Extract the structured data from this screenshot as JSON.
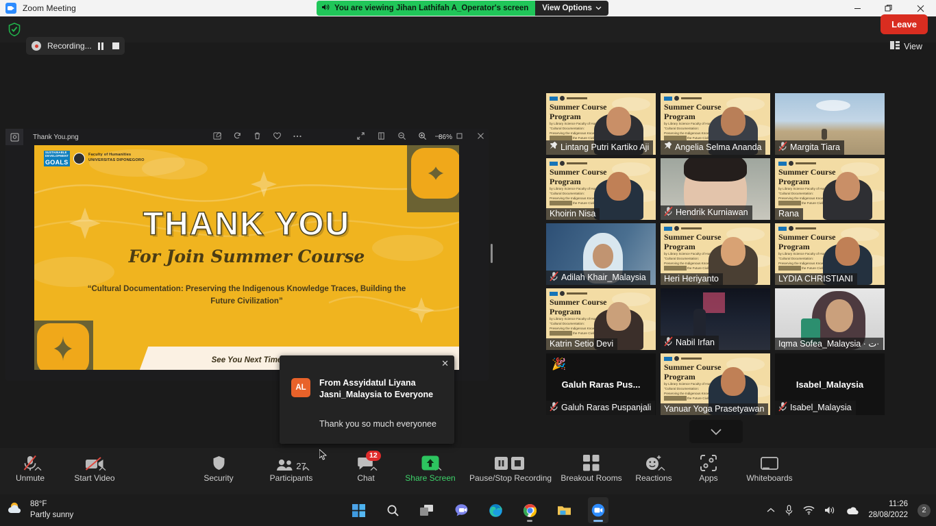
{
  "window": {
    "title": "Zoom Meeting",
    "minimize_label": "Minimize",
    "restore_label": "Restore",
    "close_label": "Close"
  },
  "share_banner": {
    "text": "You are viewing Jihan Lathifah A_Operator's screen",
    "view_options_label": "View Options",
    "speaker_icon": "speaker-icon",
    "chevron": "chevron-down-icon",
    "green": "#20c659"
  },
  "top_strip": {
    "shield_icon": "security-shield-icon",
    "recording_label": "Recording...",
    "pause_icon": "pause-icon",
    "stop_icon": "stop-icon",
    "view_label": "View",
    "view_icon": "layout-view-icon"
  },
  "viewer": {
    "file_name": "Thank You.png",
    "zoom_level": "86%",
    "thumbnail_icon": "image-thumbnail-icon",
    "toolbar_icons": [
      "markup-icon",
      "rotate-icon",
      "delete-icon",
      "favorite-heart-icon",
      "more-ellipsis-icon"
    ],
    "right_icons": [
      "fullscreen-icon",
      "fit-page-icon",
      "zoom-out-icon",
      "zoom-in-icon"
    ],
    "window_icons": [
      "minimize-icon",
      "restore-icon",
      "close-icon"
    ]
  },
  "slide": {
    "sdg_line1": "SUSTAINABLE",
    "sdg_line2": "DEVELOPMENT",
    "sdg_line3": "GOALS",
    "faculty_line1": "Faculty of Humanities",
    "faculty_line2": "UNIVERSITAS DIPONEGORO",
    "title": "THANK YOU",
    "subtitle": "For Join Summer Course",
    "quote": "“Cultural Documentation: Preserving the Indigenous Knowledge Traces, Building the Future Civilization”",
    "footer": "See You Next Time",
    "bg_color": "#f0b41f"
  },
  "chat_toast": {
    "avatar_initials": "AL",
    "avatar_color": "#e8622a",
    "from": "From Assyidatul Liyana Jasni_Malaysia to Everyone",
    "message": "Thank you so much everyonee",
    "close_icon": "close-icon"
  },
  "gallery": {
    "active_border_color": "#d9e021",
    "scroll_down_icon": "chevron-down-icon",
    "tiles": [
      {
        "name": "Lintang Putri Kartiko Aji",
        "muted": false,
        "pinned": true,
        "video": true,
        "type": "poster-person",
        "active": false
      },
      {
        "name": "Angelia Selma Ananda",
        "muted": false,
        "pinned": true,
        "video": true,
        "type": "poster-person",
        "active": false
      },
      {
        "name": "Margita Tiara",
        "muted": true,
        "pinned": false,
        "video": true,
        "type": "outdoor",
        "active": false
      },
      {
        "name": "Khoirin Nisa",
        "muted": false,
        "pinned": false,
        "video": true,
        "type": "poster-person",
        "active": false
      },
      {
        "name": "Hendrik Kurniawan",
        "muted": true,
        "pinned": false,
        "video": true,
        "type": "face-closeup",
        "active": false
      },
      {
        "name": "Rana",
        "muted": false,
        "pinned": false,
        "video": true,
        "type": "poster-person",
        "active": false
      },
      {
        "name": "Adilah Khair_Malaysia",
        "muted": true,
        "pinned": false,
        "video": true,
        "type": "indoor-blue",
        "active": false
      },
      {
        "name": "Heri Heriyanto",
        "muted": false,
        "pinned": false,
        "video": true,
        "type": "poster-person",
        "active": false
      },
      {
        "name": "LYDIA CHRISTIANI",
        "muted": false,
        "pinned": false,
        "video": true,
        "type": "poster-person",
        "active": true
      },
      {
        "name": "Katrin Setio Devi",
        "muted": false,
        "pinned": false,
        "video": true,
        "type": "poster-person",
        "active": false
      },
      {
        "name": "Nabil Irfan",
        "muted": true,
        "pinned": false,
        "video": true,
        "type": "night-street",
        "active": false
      },
      {
        "name": "Iqma Sofea_Malaysia · ت·",
        "muted": false,
        "pinned": false,
        "video": true,
        "type": "selfie-indoor",
        "active": false
      },
      {
        "name": "Galuh Raras Puspanjali",
        "display_name": "Galuh Raras Pus...",
        "muted": true,
        "pinned": false,
        "video": false,
        "type": "no-video",
        "reaction": "🎉",
        "active": false
      },
      {
        "name": "Yanuar Yoga Prasetyawan",
        "muted": false,
        "pinned": false,
        "video": true,
        "type": "poster-person",
        "active": false
      },
      {
        "name": "Isabel_Malaysia",
        "display_name": "Isabel_Malaysia",
        "muted": true,
        "pinned": false,
        "video": false,
        "type": "no-video",
        "active": true
      }
    ]
  },
  "controls": [
    {
      "id": "unmute",
      "label": "Unmute",
      "icon": "mic-muted-icon",
      "caret": true,
      "badge": null,
      "count": null,
      "highlight": null
    },
    {
      "id": "start-video",
      "label": "Start Video",
      "icon": "camera-off-icon",
      "caret": true,
      "badge": null,
      "count": null,
      "highlight": null
    },
    {
      "id": "security",
      "label": "Security",
      "icon": "shield-icon",
      "caret": false,
      "badge": null,
      "count": null,
      "highlight": null
    },
    {
      "id": "participants",
      "label": "Participants",
      "icon": "people-icon",
      "caret": true,
      "badge": null,
      "count": "27",
      "highlight": null
    },
    {
      "id": "chat",
      "label": "Chat",
      "icon": "chat-bubble-icon",
      "caret": true,
      "badge": "12",
      "count": null,
      "highlight": null
    },
    {
      "id": "share-screen",
      "label": "Share Screen",
      "icon": "share-screen-icon",
      "caret": true,
      "badge": null,
      "count": null,
      "highlight": "#3ed46b"
    },
    {
      "id": "recording",
      "label": "Pause/Stop Recording",
      "icon": "pause-stop-icon",
      "caret": false,
      "badge": null,
      "count": null,
      "highlight": null
    },
    {
      "id": "breakout",
      "label": "Breakout Rooms",
      "icon": "grid-rooms-icon",
      "caret": false,
      "badge": null,
      "count": null,
      "highlight": null
    },
    {
      "id": "reactions",
      "label": "Reactions",
      "icon": "smiley-plus-icon",
      "caret": true,
      "badge": null,
      "count": null,
      "highlight": null
    },
    {
      "id": "apps",
      "label": "Apps",
      "icon": "apps-icon",
      "caret": false,
      "badge": null,
      "count": null,
      "highlight": null
    },
    {
      "id": "whiteboards",
      "label": "Whiteboards",
      "icon": "whiteboard-icon",
      "caret": false,
      "badge": null,
      "count": null,
      "highlight": null
    }
  ],
  "leave_button": {
    "label": "Leave",
    "color": "#d92d20"
  },
  "taskbar": {
    "weather_temp": "88°F",
    "weather_desc": "Partly sunny",
    "weather_icon": "partly-sunny-icon",
    "apps": [
      {
        "id": "start",
        "icon": "windows-start-icon",
        "state": "idle"
      },
      {
        "id": "search",
        "icon": "search-icon",
        "state": "idle"
      },
      {
        "id": "task-view",
        "icon": "task-view-icon",
        "state": "idle"
      },
      {
        "id": "teams",
        "icon": "teams-chat-icon",
        "state": "idle"
      },
      {
        "id": "edge",
        "icon": "edge-browser-icon",
        "state": "idle"
      },
      {
        "id": "chrome",
        "icon": "chrome-browser-icon",
        "state": "running"
      },
      {
        "id": "file-explorer",
        "icon": "folder-icon",
        "state": "idle"
      },
      {
        "id": "zoom",
        "icon": "zoom-app-icon",
        "state": "active"
      }
    ],
    "tray": {
      "chevron_icon": "show-hidden-icons-icon",
      "mic_icon": "microphone-icon",
      "wifi_icon": "wifi-icon",
      "volume_icon": "volume-icon",
      "onedrive_icon": "onedrive-icon",
      "time": "11:26",
      "date": "28/08/2022",
      "notification_count": "2"
    }
  }
}
